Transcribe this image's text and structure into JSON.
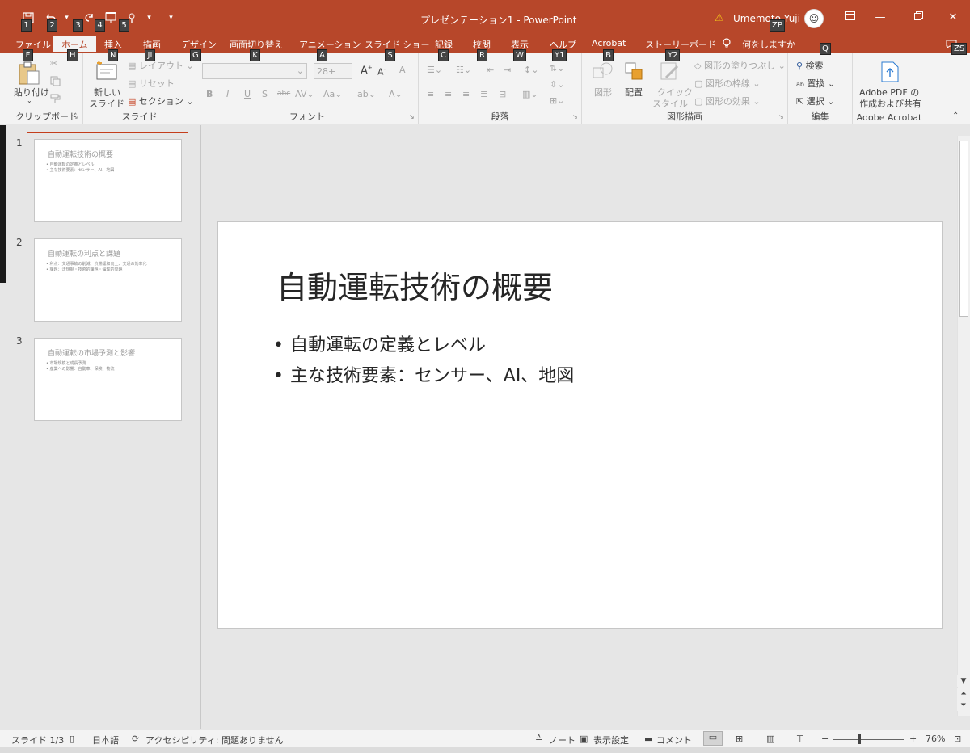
{
  "window": {
    "title": "プレゼンテーション1 - PowerPoint",
    "user": "Umemoto Yuji"
  },
  "qat_keytips": [
    "1",
    "2",
    "3",
    "4",
    "5"
  ],
  "tabs": [
    {
      "label": "ファイル",
      "key": "F"
    },
    {
      "label": "ホーム",
      "key": "H"
    },
    {
      "label": "挿入",
      "key": "N"
    },
    {
      "label": "描画",
      "key": "JI"
    },
    {
      "label": "デザイン",
      "key": "G"
    },
    {
      "label": "画面切り替え",
      "key": "K"
    },
    {
      "label": "アニメーション",
      "key": "A"
    },
    {
      "label": "スライド ショー",
      "key": "S"
    },
    {
      "label": "記録",
      "key": "C"
    },
    {
      "label": "校閲",
      "key": "R"
    },
    {
      "label": "表示",
      "key": "W"
    },
    {
      "label": "ヘルプ",
      "key": "Y1"
    },
    {
      "label": "Acrobat",
      "key": "B"
    },
    {
      "label": "ストーリーボード",
      "key": "Y2"
    },
    {
      "label": "何をしますか",
      "key": "Q"
    }
  ],
  "extra_keytips": {
    "zp": "ZP",
    "zs": "ZS"
  },
  "ribbon": {
    "clipboard": {
      "paste": "貼り付け",
      "label": "クリップボード"
    },
    "slides": {
      "new_slide": "新しい",
      "new_slide2": "スライド",
      "layout": "レイアウト",
      "reset": "リセット",
      "section": "セクション",
      "label": "スライド"
    },
    "font": {
      "size": "28+",
      "label": "フォント"
    },
    "paragraph": {
      "label": "段落"
    },
    "drawing": {
      "shape": "図形",
      "arrange": "配置",
      "quick_style": "クイック",
      "quick_style2": "スタイル",
      "fill": "図形の塗りつぶし",
      "outline": "図形の枠線",
      "effect": "図形の効果",
      "label": "図形描画"
    },
    "editing": {
      "find": "検索",
      "replace": "置換",
      "select": "選択",
      "label": "編集"
    },
    "acrobat": {
      "btn1": "Adobe PDF の",
      "btn2": "作成および共有",
      "label": "Adobe Acrobat"
    }
  },
  "thumbnails": [
    {
      "num": "1",
      "title": "自動運転技術の概要",
      "lines": [
        "• 自動運転の定義とレベル",
        "• 主な技術要素：センサー、AI、地図"
      ]
    },
    {
      "num": "2",
      "title": "自動運転の利点と課題",
      "lines": [
        "• 利点：交通事故の削減、渋滞緩和向上、交通の効率化",
        "• 課題：法規制・技術的課題・倫理的問題"
      ]
    },
    {
      "num": "3",
      "title": "自動運転の市場予測と影響",
      "lines": [
        "• 市場規模と成長予測",
        "• 産業への影響：自動車、保険、物流"
      ]
    }
  ],
  "slide": {
    "title": "自動運転技術の概要",
    "bullets": [
      "自動運転の定義とレベル",
      "主な技術要素：センサー、AI、地図"
    ]
  },
  "status": {
    "slide": "スライド 1/3",
    "lang": "日本語",
    "access": "アクセシビリティ: 問題ありません",
    "notes": "ノート",
    "display": "表示設定",
    "comments": "コメント",
    "zoom": "76%"
  }
}
